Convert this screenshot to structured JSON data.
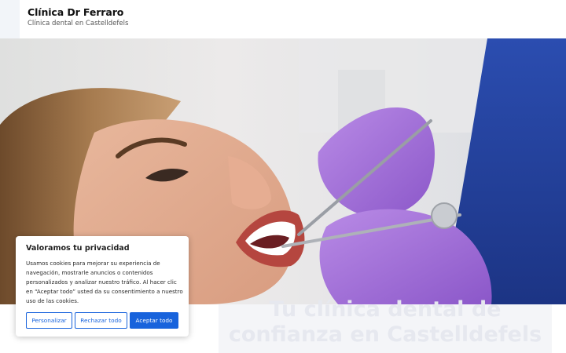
{
  "site": {
    "title": "Clínica Dr Ferraro",
    "tagline": "Clínica dental en Castelldefels"
  },
  "hero": {
    "image_description_icon": "dental-exam-photo",
    "headline_line1": "Tu clínica dental de",
    "headline_line2": "confianza en Castelldefels"
  },
  "cookie_banner": {
    "title": "Valoramos tu privacidad",
    "body": "Usamos cookies para mejorar su experiencia de navegación, mostrarle anuncios o contenidos personalizados y analizar nuestro tráfico. Al hacer clic en “Aceptar todo” usted da su consentimiento a nuestro uso de las cookies.",
    "customize_label": "Personalizar",
    "reject_label": "Rechazar todo",
    "accept_label": "Aceptar todo",
    "accent_color": "#1863dc"
  }
}
